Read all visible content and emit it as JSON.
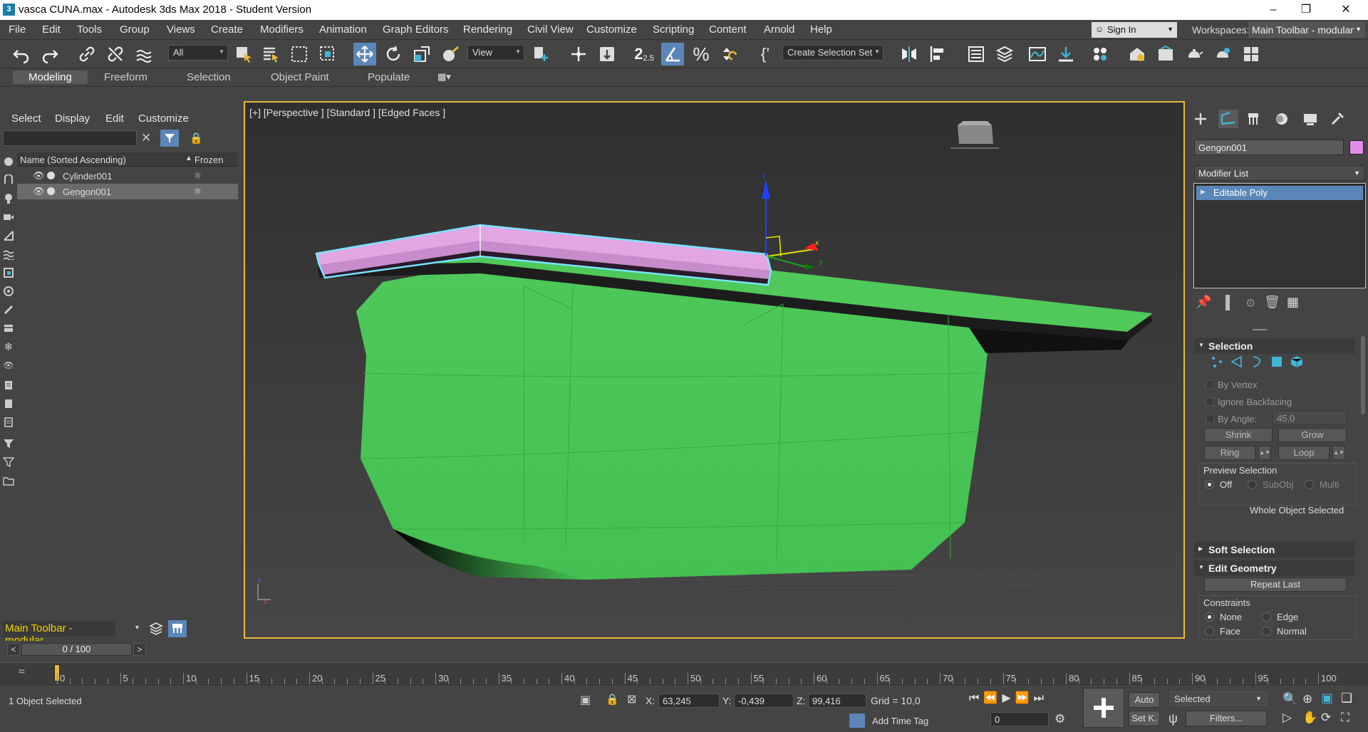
{
  "window": {
    "title": "vasca CUNA.max - Autodesk 3ds Max 2018 - Student Version"
  },
  "menu": [
    "File",
    "Edit",
    "Tools",
    "Group",
    "Views",
    "Create",
    "Modifiers",
    "Animation",
    "Graph Editors",
    "Rendering",
    "Civil View",
    "Customize",
    "Scripting",
    "Content",
    "Arnold",
    "Help"
  ],
  "account": {
    "sign_in": "Sign In",
    "workspaces_label": "Workspaces:",
    "workspace": "Main Toolbar - modular"
  },
  "toolbar": {
    "filter": "All",
    "ref_coord": "View",
    "snap_label": "2.5",
    "selection_set": "Create Selection Set"
  },
  "ribbon": {
    "tabs": [
      "Modeling",
      "Freeform",
      "Selection",
      "Object Paint",
      "Populate"
    ]
  },
  "explorer": {
    "menus": [
      "Select",
      "Display",
      "Edit",
      "Customize"
    ],
    "col_name": "Name (Sorted Ascending)",
    "col_frozen": "Frozen",
    "rows": [
      {
        "name": "Cylinder001"
      },
      {
        "name": "Gengon001"
      }
    ]
  },
  "viewport": {
    "label": "[+] [Perspective ] [Standard ] [Edged Faces ]"
  },
  "command_panel": {
    "object_name": "Gengon001",
    "object_color": "#e38be6",
    "modifier_list": "Modifier List",
    "stack": [
      "Editable Poly"
    ],
    "selection": {
      "title": "Selection",
      "by_vertex": "By Vertex",
      "ignore_backfacing": "Ignore Backfacing",
      "by_angle": "By Angle:",
      "angle_value": "45,0",
      "shrink": "Shrink",
      "grow": "Grow",
      "ring": "Ring",
      "loop": "Loop",
      "preview_title": "Preview Selection",
      "preview_off": "Off",
      "preview_subobj": "SubObj",
      "preview_multi": "Multi",
      "status": "Whole Object Selected"
    },
    "soft_selection": "Soft Selection",
    "edit_geometry": {
      "title": "Edit Geometry",
      "repeat_last": "Repeat Last",
      "constraints": "Constraints",
      "none": "None",
      "edge": "Edge",
      "face": "Face",
      "normal": "Normal"
    }
  },
  "layer_bar": {
    "name": "Main Toolbar - modular"
  },
  "timeline": {
    "frame_display": "0 / 100",
    "labels": [
      0,
      5,
      10,
      15,
      20,
      25,
      30,
      35,
      40,
      45,
      50,
      55,
      60,
      65,
      70,
      75,
      80,
      85,
      90,
      95,
      100
    ]
  },
  "status": {
    "selected": "1 Object Selected",
    "x_label": "X:",
    "x": "63,245",
    "y_label": "Y:",
    "y": "-0,439",
    "z_label": "Z:",
    "z": "99,416",
    "grid": "Grid = 10,0",
    "add_time_tag": "Add Time Tag",
    "auto": "Auto",
    "set_key": "Set K.",
    "selected_set": "Selected",
    "filters": "Filters...",
    "current_frame": "0"
  },
  "colors": {
    "accent": "#5b86b8",
    "viewport_border": "#e8b93a",
    "model_green": "#4bcb57",
    "selected_pink": "#e2a6e3",
    "yellow_text": "#f0d000"
  }
}
